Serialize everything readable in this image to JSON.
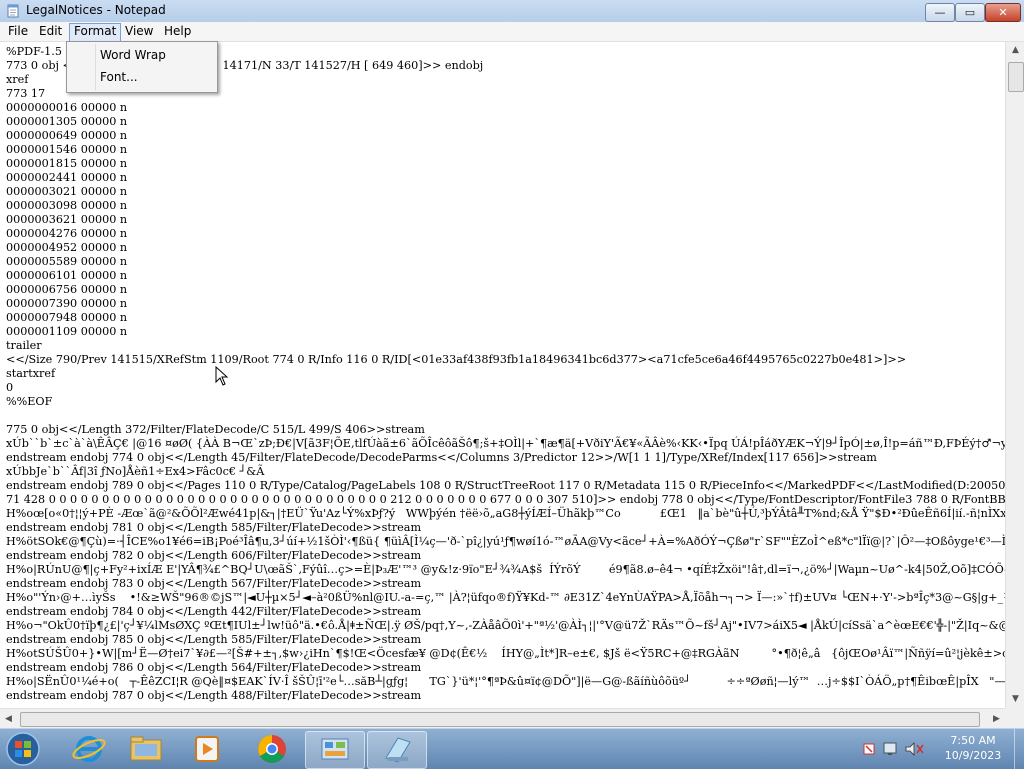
{
  "window": {
    "title": "LegalNotices - Notepad",
    "controls": {
      "minimize": "—",
      "maximize": "▭",
      "close": "✕"
    }
  },
  "menubar": {
    "file": "File",
    "edit": "Edit",
    "format": "Format",
    "view": "View",
    "help": "Help"
  },
  "format_menu": {
    "word_wrap": "Word Wrap",
    "font": "Font..."
  },
  "editor": {
    "text": "%PDF-1.5 %\n773 0 obj <                                776/E 14171/N 33/T 141527/H [ 649 460]>> endobj\nxref\n773 17\n0000000016 00000 n\n0000001305 00000 n\n0000000649 00000 n\n0000001546 00000 n\n0000001815 00000 n\n0000002441 00000 n\n0000003021 00000 n\n0000003098 00000 n\n0000003621 00000 n\n0000004276 00000 n\n0000004952 00000 n\n0000005589 00000 n\n0000006101 00000 n\n0000006756 00000 n\n0000007390 00000 n\n0000007948 00000 n\n0000001109 00000 n\ntrailer\n<</Size 790/Prev 141515/XRefStm 1109/Root 774 0 R/Info 116 0 R/ID[<01e33af438f93fb1a18496341bc6d377><a71cfe5ce6a46f4495765c0227b0e481>]>>\nstartxref\n0\n%%EOF\n\n775 0 obj<</Length 372/Filter/FlateDecode/C 515/L 499/S 406>>stream\nxÚb``b`±c`à`à\\ÊÂÇ€ |@16 ¤øØ( {ÀÀ B¬Œ`zÞ;Ð€|V[ã3F¦ÕE,tlfÚàã±6`ãÕÎcêôãŠô¶;š+‡OÌl|+`¶æ¶ä[+VðiY'Ã€¥«ÃÂè%‹KK‹•Ïpq ÚÁ!pÎáðYÆK¬Ý|9┘ÎpÓ|±ø,Î!p=áñ™Ð,FÞÉý†♂¬y#  Þç~6ÇÌ€┼#€û¬Ý┘ÀC\nendstream endobj 774 0 obj<</Length 45/Filter/FlateDecode/DecodeParms<</Columns 3/Predictor 12>>/W[1 1 1]/Type/XRef/Index[117 656]>>stream\nxÚbbJe`b``Âf|3î ƒNo]Åèñ1÷Ex4>Fâc0c€ ┘&Ã\nendstream endobj 789 0 obj<</Pages 110 0 R/Type/Catalog/PageLabels 108 0 R/StructTreeRoot 117 0 R/Metadata 115 0 R/PieceInfo<</MarkedPDF<</LastModified(D:20050203154754)\n71 428 0 0 0 0 0 0 0 0 0 0 0 0 0 0 0 0 0 0 0 0 0 0 0 0 0 0 0 0 0 0 0 0 212 0 0 0 0 0 0 0 677 0 0 0 307 510]>> endobj 778 0 obj<</Type/FontDescriptor/FontFile3 788 0 R/FontBB\nH%oœ[o«0†¦¦ý+PÈ -Æœ`ã@²&ÕÕl²Æwé41p|&┐|†EÜ`Ÿu'Az└Ý%xÞƒ?ý   WWþýén †ëë›õ„aG8┼ýÍÆÍ–Ühãkþ™Co           £Œ1   ‖a`bè\"û┼Ú,³þÝÂtâ╨T%nd;&Å Ÿ\"$Ð•²ÐûeÊñ6Í|ií.-ñ¦nÌXxú+¹Ôâöþ9i\nendstream endobj 781 0 obj<</Length 585/Filter/FlateDecode>>stream\nH%ötSOk€@¶Çù)=·┤ÎCE%o1¥é6=iB¡Poé³Îâ¶u,3┘úí+½1šÒÌ'‹¶ßü{ ¶üìÂ[Ì¼ç—'ð-`pî¿|yú¹ƒ¶wøí1ó-™øÃA@Vy<ãce┘+À=%AðÓÝ¬Çßø\"r`SF\"\"ÈZoÌ^eß*c\"lÏï@|?`|Ô²—‡Oßôyge¹€³—Ì†|…Ä¬|Oòþ(┘µÿù\nendstream endobj 782 0 obj<</Length 606/Filter/FlateDecode>>stream\nH%o|RÚnU@¶|ç+Fy²+ixÍÆ E'|YÂ¶¾£^BQ┘U\\œãŠ`,Fýûî…ç>=È|Þ₃Æ'™³ @y&!z·9ïo\"E┘¾¾A$š  ÍÝrõÝ        é9¶ã8.ø–ê4¬ •qíÉ‡Žxöi\"!â†,dl=ï¬,¿ö%┘|Waµn~Uø^-k4|50Ž,Oõ]‡CÓÕ-      ¶èvu‹cuz-Ûn\nendstream endobj 783 0 obj<</Length 567/Filter/FlateDecode>>stream\nH%o\"'Ýn›@+…ìyŠs    •!&≥WŠ\"96®©jS™|◄U┼µ×5┘◄–à²0ßÜ%nl@IU.-a-=ç,™ |À?¦üfqo®f)Ÿ¥Kd-™ ∂E31Z`4eYnÙAŸPA>Å,Ïõåh¬┐¬> Ï—:»`†f)±UV¤ └ŒN+·Y'->bªÎç*3@~G§|g+_½-¨ÃÂ`»ß«#ß └Ý↨â8_Ô„\nendstream endobj 784 0 obj<</Length 442/Filter/FlateDecode>>stream\nH%o¬\"OkÛ0†ïþ¶¿£|'ç┘¥¼lMsØXÇ ºŒt¶IUl±┘lw!üô\"ä.•€ô.Å|ǂ±ÑŒ|.ÿ ØŠ/pq†,Y~,-ZÀåâÕ0ì'+\"ª½'@ÀÌ┐¦|'°V@ü7Ž`RÄs™Õ~fš┘Aj\"•IV7>áiX5◄ |ÅkÚ|cíSsä`a^èœE€€'╬-|\"Ž|Iq~&@Z3 |â\nendstream endobj 785 0 obj<</Length 585/Filter/FlateDecode>>stream\nH%otSÚŠÛ0+}•W|[m┘Ë—Ø†ei7`¥∂£—²[Š#+±┐,$w›¿iHn`¶$!Œ<Öcesfæ¥ @D¢(Ê€½    ÍHY@„Ìt*]R–e±€, $Jš ë<Ÿ5RC+@‡RGÀãN         °•¶ð¦ê„â   {ôjŒOø¹Âï™|Ññÿí=û²¦jèkê±>œ2fpâs¬µ€Ìl@Ø¡+Á\nendstream endobj 786 0 obj<</Length 564/Filter/FlateDecode>>stream\nH%o|SËnÛ0¹¼é+o(   ┬-ÊêZCI¦R @Qè‖¤$EAK`ÍV·Î šŠÛ¦ī'²e└…săB┴|gƒg¦      TG`}'ü*¦'°¶ªÞ&û¤ï¢@DÕ\"]|ë—G@-ßãíñùôõüº┘          ÷÷ªØøñ¦—lý™  …j÷$$I`ÒÁÖ„p†¶ÊibœÊ|pÎX   \"—„Ñ┐◄¤x∂äý∂x¬–8\"ú\nendstream endobj 787 0 obj<</Length 488/Filter/FlateDecode>>stream"
  },
  "taskbar": {
    "clock_time": "7:50 AM",
    "clock_date": "10/9/2023",
    "apps": [
      "start-orb",
      "internet-explorer",
      "file-explorer",
      "media-player",
      "chrome",
      "control-panel",
      "notepad"
    ]
  },
  "colors": {
    "taskbar": "#6f93bc",
    "titlebar": "#bfd4ee",
    "menu_highlight": "#dfe9f8"
  }
}
